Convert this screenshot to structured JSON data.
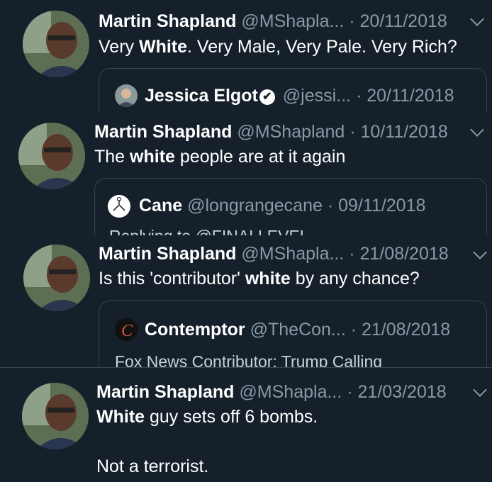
{
  "tweets": [
    {
      "name": "Martin Shapland",
      "handle": "@MShapla...",
      "sep": " · ",
      "date": "20/11/2018",
      "text_parts": [
        "Very ",
        "White",
        ". Very Male, Very Pale. Very Rich?"
      ],
      "quote": {
        "name": "Jessica Elgot",
        "handle": "@jessi...",
        "sep": " · ",
        "date": "20/11/2018",
        "body": ""
      }
    },
    {
      "name": "Martin Shapland",
      "handle": "@MShapland",
      "sep": " · ",
      "date": "10/11/2018",
      "text_parts": [
        "The ",
        "white",
        " people are at it again"
      ],
      "quote": {
        "name": "Cane",
        "handle": "@longrangecane",
        "sep": " · ",
        "date": "09/11/2018",
        "body": "Replying to @FINALLEVEL"
      }
    },
    {
      "name": "Martin Shapland",
      "handle": "@MShapla...",
      "sep": " · ",
      "date": "21/08/2018",
      "text_parts": [
        "Is this 'contributor' ",
        "white",
        " by any chance?"
      ],
      "quote": {
        "name": "Contemptor",
        "handle": "@TheCon...",
        "sep": " · ",
        "date": "21/08/2018",
        "body": "Fox News Contributor: Trump Calling"
      }
    },
    {
      "name": "Martin Shapland",
      "handle": "@MShapla...",
      "sep": " · ",
      "date": "21/03/2018",
      "text_parts": [
        "White",
        " guy sets off 6 bombs."
      ],
      "text_line2": "Not a terrorist."
    }
  ],
  "icons": {
    "verified": "✔",
    "chevron": "chevron-down-icon",
    "contemptor_logo": "C"
  },
  "colors": {
    "background": "#15202b",
    "secondary_text": "#8899a6",
    "border": "#38444d"
  }
}
